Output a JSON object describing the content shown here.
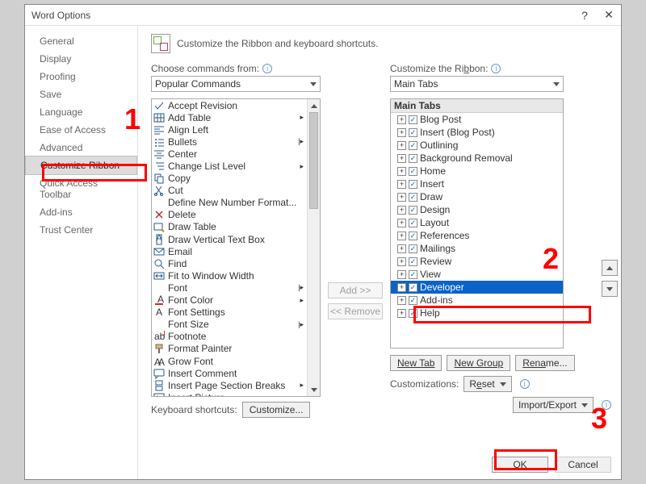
{
  "title": "Word Options",
  "header_text": "Customize the Ribbon and keyboard shortcuts.",
  "sidebar": {
    "items": [
      "General",
      "Display",
      "Proofing",
      "Save",
      "Language",
      "Ease of Access",
      "Advanced",
      "Customize Ribbon",
      "Quick Access Toolbar",
      "Add-ins",
      "Trust Center"
    ],
    "active_index": 7
  },
  "left": {
    "label_pre": "C",
    "label_rest": "hoose commands from:",
    "dropdown": "Popular Commands",
    "commands": [
      {
        "icon": "accept",
        "label": "Accept Revision"
      },
      {
        "icon": "table",
        "label": "Add Table",
        "submenu": true
      },
      {
        "icon": "alignl",
        "label": "Align Left"
      },
      {
        "icon": "bullets",
        "label": "Bullets",
        "submenu": true,
        "split": true
      },
      {
        "icon": "center",
        "label": "Center"
      },
      {
        "icon": "listlvl",
        "label": "Change List Level",
        "submenu": true
      },
      {
        "icon": "copy",
        "label": "Copy"
      },
      {
        "icon": "cut",
        "label": "Cut"
      },
      {
        "icon": "",
        "label": "Define New Number Format..."
      },
      {
        "icon": "delete",
        "label": "Delete"
      },
      {
        "icon": "drawtbl",
        "label": "Draw Table"
      },
      {
        "icon": "vtext",
        "label": "Draw Vertical Text Box"
      },
      {
        "icon": "mail",
        "label": "Email"
      },
      {
        "icon": "find",
        "label": "Find"
      },
      {
        "icon": "fit",
        "label": "Fit to Window Width"
      },
      {
        "icon": "",
        "label": "Font",
        "split": true
      },
      {
        "icon": "fcolor",
        "label": "Font Color",
        "submenu": true
      },
      {
        "icon": "fset",
        "label": "Font Settings"
      },
      {
        "icon": "",
        "label": "Font Size",
        "split": true
      },
      {
        "icon": "foot",
        "label": "Footnote"
      },
      {
        "icon": "fpaint",
        "label": "Format Painter"
      },
      {
        "icon": "grow",
        "label": "Grow Font"
      },
      {
        "icon": "comment",
        "label": "Insert Comment"
      },
      {
        "icon": "pgbrk",
        "label": "Insert Page  Section Breaks",
        "submenu": true
      },
      {
        "icon": "pic",
        "label": "Insert Picture"
      }
    ]
  },
  "mid": {
    "add": "Add >>",
    "remove": "<< Remove"
  },
  "right": {
    "label_pre": "Customize the Ri",
    "label_u": "b",
    "label_post": "bon:",
    "dropdown": "Main Tabs",
    "tree_heading": "Main Tabs",
    "nodes": [
      {
        "label": "Blog Post",
        "checked": true
      },
      {
        "label": "Insert (Blog Post)",
        "checked": true
      },
      {
        "label": "Outlining",
        "checked": true
      },
      {
        "label": "Background Removal",
        "checked": true
      },
      {
        "label": "Home",
        "checked": true
      },
      {
        "label": "Insert",
        "checked": true
      },
      {
        "label": "Draw",
        "checked": true
      },
      {
        "label": "Design",
        "checked": true
      },
      {
        "label": "Layout",
        "checked": true
      },
      {
        "label": "References",
        "checked": true
      },
      {
        "label": "Mailings",
        "checked": true
      },
      {
        "label": "Review",
        "checked": true
      },
      {
        "label": "View",
        "checked": true
      },
      {
        "label": "Developer",
        "checked": true,
        "selected": true
      },
      {
        "label": "Add-ins",
        "checked": true
      },
      {
        "label": "Help",
        "checked": true
      }
    ],
    "new_tab": "New Tab",
    "new_group": "New Group",
    "rename": "Rename...",
    "customizations_label": "Customizations:",
    "reset": "Reset",
    "import_export": "Import/Export"
  },
  "keyboard": {
    "label": "Keyboard shortcuts:",
    "button": "Customize..."
  },
  "footer": {
    "ok": "OK",
    "cancel": "Cancel"
  },
  "annotations": {
    "n1": "1",
    "n2": "2",
    "n3": "3"
  }
}
